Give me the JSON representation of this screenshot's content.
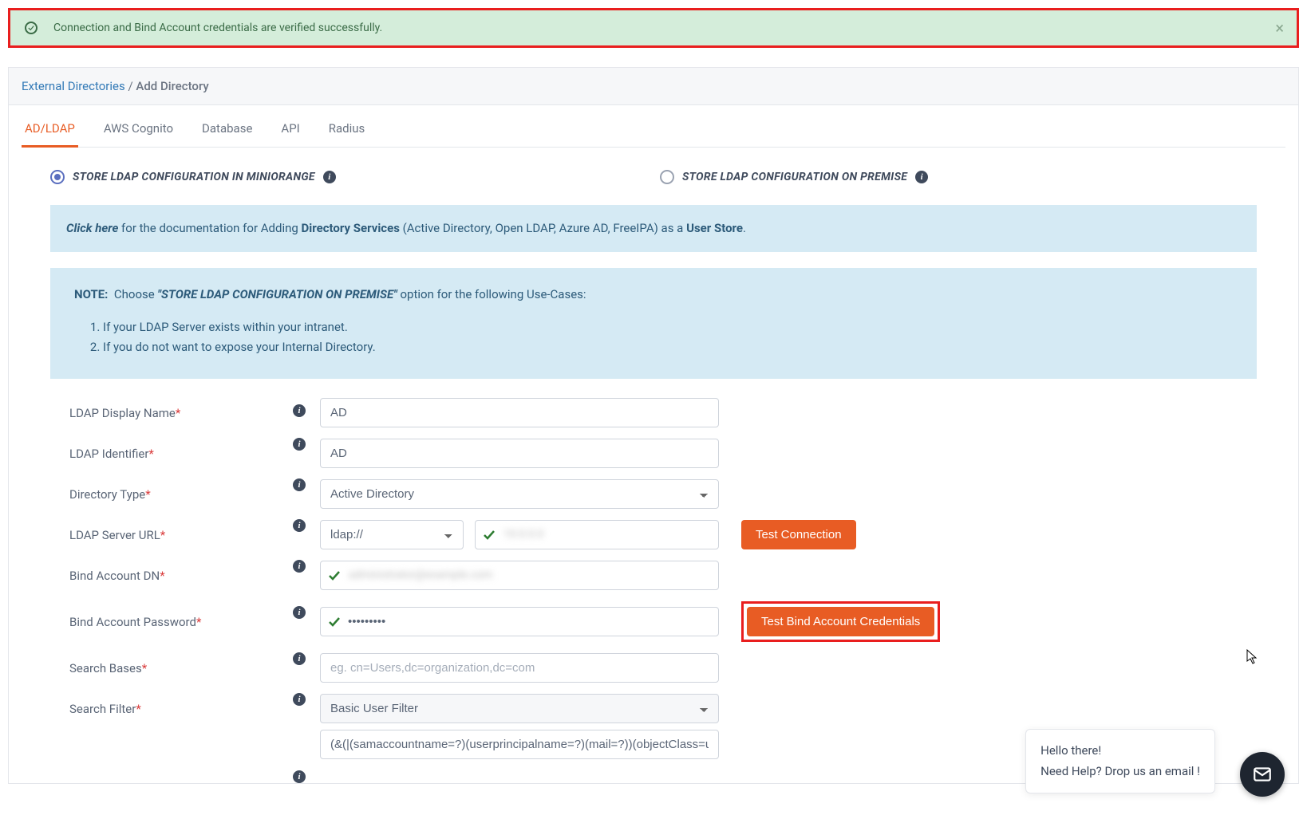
{
  "alert_message": "Connection and Bind Account credentials are verified successfully.",
  "breadcrumb": {
    "parent": "External Directories",
    "sep": "/",
    "current": "Add Directory"
  },
  "tabs": [
    {
      "label": "AD/LDAP"
    },
    {
      "label": "AWS Cognito"
    },
    {
      "label": "Database"
    },
    {
      "label": "API"
    },
    {
      "label": "Radius"
    }
  ],
  "radio": {
    "opt1": "STORE LDAP CONFIGURATION IN MINIORANGE",
    "opt2": "STORE LDAP CONFIGURATION ON PREMISE"
  },
  "doc_hint": {
    "click_here": "Click here",
    "mid1": " for the documentation for Adding ",
    "dir_svc": "Directory Services",
    "mid2": " (Active Directory, Open LDAP, Azure AD, FreeIPA) as a ",
    "user_store": "User Store",
    "end": "."
  },
  "note": {
    "label": "NOTE:",
    "lead": "Choose ",
    "quoted": "\"STORE LDAP CONFIGURATION ON PREMISE\"",
    "tail": " option for the following Use-Cases:",
    "items": [
      "If your LDAP Server exists within your intranet.",
      "If you do not want to expose your Internal Directory."
    ]
  },
  "form": {
    "display_name": {
      "label": "LDAP Display Name",
      "value": "AD"
    },
    "identifier": {
      "label": "LDAP Identifier",
      "value": "AD"
    },
    "dir_type": {
      "label": "Directory Type",
      "value": "Active Directory"
    },
    "server_url": {
      "label": "LDAP Server URL",
      "protocol": "ldap://",
      "host_blur": "10.0.0.0"
    },
    "bind_dn": {
      "label": "Bind Account DN",
      "value_blur": "administrator@example.com"
    },
    "bind_pw": {
      "label": "Bind Account Password",
      "value": "•••••••••"
    },
    "search_bases": {
      "label": "Search Bases",
      "placeholder": "eg. cn=Users,dc=organization,dc=com"
    },
    "search_filter": {
      "label": "Search Filter",
      "value": "Basic User Filter",
      "expr": "(&(|(samaccountname=?)(userprincipalname=?)(mail=?))(objectClass=user))"
    }
  },
  "buttons": {
    "test_conn": "Test Connection",
    "test_bind": "Test Bind Account Credentials"
  },
  "chat": {
    "line1": "Hello there!",
    "line2": "Need Help? Drop us an email !"
  }
}
